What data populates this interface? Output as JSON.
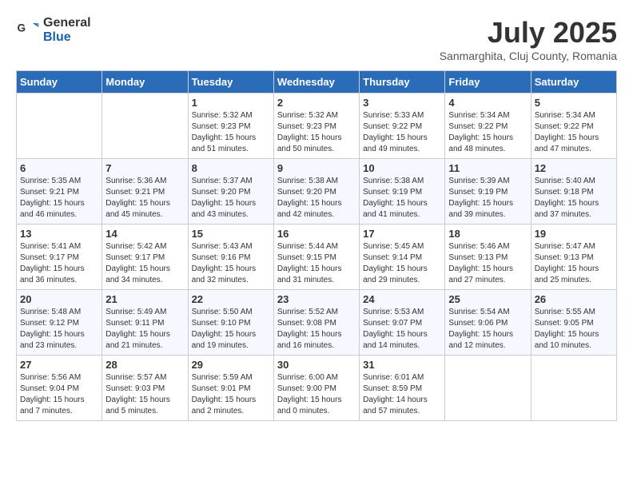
{
  "header": {
    "logo_general": "General",
    "logo_blue": "Blue",
    "month_title": "July 2025",
    "location": "Sanmarghita, Cluj County, Romania"
  },
  "days_of_week": [
    "Sunday",
    "Monday",
    "Tuesday",
    "Wednesday",
    "Thursday",
    "Friday",
    "Saturday"
  ],
  "weeks": [
    [
      {
        "day": "",
        "info": ""
      },
      {
        "day": "",
        "info": ""
      },
      {
        "day": "1",
        "info": "Sunrise: 5:32 AM\nSunset: 9:23 PM\nDaylight: 15 hours\nand 51 minutes."
      },
      {
        "day": "2",
        "info": "Sunrise: 5:32 AM\nSunset: 9:23 PM\nDaylight: 15 hours\nand 50 minutes."
      },
      {
        "day": "3",
        "info": "Sunrise: 5:33 AM\nSunset: 9:22 PM\nDaylight: 15 hours\nand 49 minutes."
      },
      {
        "day": "4",
        "info": "Sunrise: 5:34 AM\nSunset: 9:22 PM\nDaylight: 15 hours\nand 48 minutes."
      },
      {
        "day": "5",
        "info": "Sunrise: 5:34 AM\nSunset: 9:22 PM\nDaylight: 15 hours\nand 47 minutes."
      }
    ],
    [
      {
        "day": "6",
        "info": "Sunrise: 5:35 AM\nSunset: 9:21 PM\nDaylight: 15 hours\nand 46 minutes."
      },
      {
        "day": "7",
        "info": "Sunrise: 5:36 AM\nSunset: 9:21 PM\nDaylight: 15 hours\nand 45 minutes."
      },
      {
        "day": "8",
        "info": "Sunrise: 5:37 AM\nSunset: 9:20 PM\nDaylight: 15 hours\nand 43 minutes."
      },
      {
        "day": "9",
        "info": "Sunrise: 5:38 AM\nSunset: 9:20 PM\nDaylight: 15 hours\nand 42 minutes."
      },
      {
        "day": "10",
        "info": "Sunrise: 5:38 AM\nSunset: 9:19 PM\nDaylight: 15 hours\nand 41 minutes."
      },
      {
        "day": "11",
        "info": "Sunrise: 5:39 AM\nSunset: 9:19 PM\nDaylight: 15 hours\nand 39 minutes."
      },
      {
        "day": "12",
        "info": "Sunrise: 5:40 AM\nSunset: 9:18 PM\nDaylight: 15 hours\nand 37 minutes."
      }
    ],
    [
      {
        "day": "13",
        "info": "Sunrise: 5:41 AM\nSunset: 9:17 PM\nDaylight: 15 hours\nand 36 minutes."
      },
      {
        "day": "14",
        "info": "Sunrise: 5:42 AM\nSunset: 9:17 PM\nDaylight: 15 hours\nand 34 minutes."
      },
      {
        "day": "15",
        "info": "Sunrise: 5:43 AM\nSunset: 9:16 PM\nDaylight: 15 hours\nand 32 minutes."
      },
      {
        "day": "16",
        "info": "Sunrise: 5:44 AM\nSunset: 9:15 PM\nDaylight: 15 hours\nand 31 minutes."
      },
      {
        "day": "17",
        "info": "Sunrise: 5:45 AM\nSunset: 9:14 PM\nDaylight: 15 hours\nand 29 minutes."
      },
      {
        "day": "18",
        "info": "Sunrise: 5:46 AM\nSunset: 9:13 PM\nDaylight: 15 hours\nand 27 minutes."
      },
      {
        "day": "19",
        "info": "Sunrise: 5:47 AM\nSunset: 9:13 PM\nDaylight: 15 hours\nand 25 minutes."
      }
    ],
    [
      {
        "day": "20",
        "info": "Sunrise: 5:48 AM\nSunset: 9:12 PM\nDaylight: 15 hours\nand 23 minutes."
      },
      {
        "day": "21",
        "info": "Sunrise: 5:49 AM\nSunset: 9:11 PM\nDaylight: 15 hours\nand 21 minutes."
      },
      {
        "day": "22",
        "info": "Sunrise: 5:50 AM\nSunset: 9:10 PM\nDaylight: 15 hours\nand 19 minutes."
      },
      {
        "day": "23",
        "info": "Sunrise: 5:52 AM\nSunset: 9:08 PM\nDaylight: 15 hours\nand 16 minutes."
      },
      {
        "day": "24",
        "info": "Sunrise: 5:53 AM\nSunset: 9:07 PM\nDaylight: 15 hours\nand 14 minutes."
      },
      {
        "day": "25",
        "info": "Sunrise: 5:54 AM\nSunset: 9:06 PM\nDaylight: 15 hours\nand 12 minutes."
      },
      {
        "day": "26",
        "info": "Sunrise: 5:55 AM\nSunset: 9:05 PM\nDaylight: 15 hours\nand 10 minutes."
      }
    ],
    [
      {
        "day": "27",
        "info": "Sunrise: 5:56 AM\nSunset: 9:04 PM\nDaylight: 15 hours\nand 7 minutes."
      },
      {
        "day": "28",
        "info": "Sunrise: 5:57 AM\nSunset: 9:03 PM\nDaylight: 15 hours\nand 5 minutes."
      },
      {
        "day": "29",
        "info": "Sunrise: 5:59 AM\nSunset: 9:01 PM\nDaylight: 15 hours\nand 2 minutes."
      },
      {
        "day": "30",
        "info": "Sunrise: 6:00 AM\nSunset: 9:00 PM\nDaylight: 15 hours\nand 0 minutes."
      },
      {
        "day": "31",
        "info": "Sunrise: 6:01 AM\nSunset: 8:59 PM\nDaylight: 14 hours\nand 57 minutes."
      },
      {
        "day": "",
        "info": ""
      },
      {
        "day": "",
        "info": ""
      }
    ]
  ]
}
